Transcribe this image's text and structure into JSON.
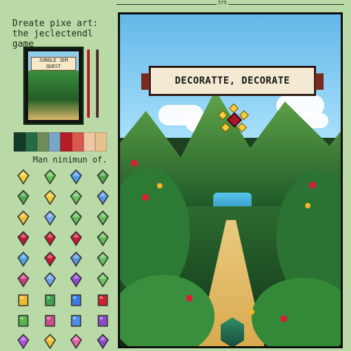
{
  "left_panel": {
    "title_line1": "Dreate pixe art:",
    "title_line2": "the jeclectendl game",
    "thumbnail_label": "JUNGLE JEM QUEST",
    "minimum_label": "Man ninimun of.",
    "palette": [
      "#143b2a",
      "#246d44",
      "#6e8d58",
      "#79a6c5",
      "#b71b28",
      "#d95a4c",
      "#efc7a7",
      "#e6c28e"
    ],
    "gems": [
      {
        "name": "gem-yellow-diamond-1",
        "color": "#f5cd34"
      },
      {
        "name": "gem-green-diamond-1",
        "color": "#63c54f"
      },
      {
        "name": "gem-blue-diamond-1",
        "color": "#4d9df0"
      },
      {
        "name": "gem-green-diamond-2",
        "color": "#4ea84d"
      },
      {
        "name": "gem-green-diamond-3",
        "color": "#4ea84d"
      },
      {
        "name": "gem-yellow-diamond-2",
        "color": "#f4cc3a"
      },
      {
        "name": "gem-green-diamond-4",
        "color": "#6bc061"
      },
      {
        "name": "gem-blue-diamond-2",
        "color": "#5a94e4"
      },
      {
        "name": "gem-yellow-diamond-3",
        "color": "#f0c232"
      },
      {
        "name": "gem-blue-diamond-3",
        "color": "#74a8ea"
      },
      {
        "name": "gem-green-diamond-5",
        "color": "#63ba59"
      },
      {
        "name": "gem-green-diamond-6",
        "color": "#63ba59"
      },
      {
        "name": "gem-red-diamond-1",
        "color": "#c31832"
      },
      {
        "name": "gem-red-diamond-2",
        "color": "#ca1a35"
      },
      {
        "name": "gem-red-diamond-3",
        "color": "#ca1a35"
      },
      {
        "name": "gem-green-diamond-7",
        "color": "#63ba59"
      },
      {
        "name": "gem-blue-diamond-4",
        "color": "#4fa4ef"
      },
      {
        "name": "gem-red-diamond-4",
        "color": "#ca1a35"
      },
      {
        "name": "gem-blue-diamond-5",
        "color": "#5b92df"
      },
      {
        "name": "gem-green-diamond-8",
        "color": "#6bc061"
      },
      {
        "name": "gem-pink-diamond-1",
        "color": "#cc3e7e"
      },
      {
        "name": "gem-blue-diamond-6",
        "color": "#6ca3ef"
      },
      {
        "name": "gem-purple-diamond-1",
        "color": "#8e48cc"
      },
      {
        "name": "gem-green-diamond-9",
        "color": "#6bc061"
      },
      {
        "name": "gem-yellow-square-1",
        "color": "#f1bc2c"
      },
      {
        "name": "gem-green-square-1",
        "color": "#3da34e"
      },
      {
        "name": "gem-blue-square-1",
        "color": "#3c7ae4"
      },
      {
        "name": "gem-red-square-1",
        "color": "#d01f30"
      },
      {
        "name": "gem-green-square-2",
        "color": "#58b64f"
      },
      {
        "name": "gem-pink-square-1",
        "color": "#d04c8e"
      },
      {
        "name": "gem-blue-square-2",
        "color": "#4f8de6"
      },
      {
        "name": "gem-purple-square-1",
        "color": "#8e48cc"
      },
      {
        "name": "gem-purple-diamond-2",
        "color": "#b14fe3"
      },
      {
        "name": "gem-yellow-diamond-4",
        "color": "#f1c338"
      },
      {
        "name": "gem-pink-diamond-2",
        "color": "#e15fa4"
      },
      {
        "name": "gem-purple-diamond-3",
        "color": "#8e48cc"
      }
    ]
  },
  "poster": {
    "banner_text": "DECORATTE, DECORATE",
    "dimension_text": "575"
  }
}
